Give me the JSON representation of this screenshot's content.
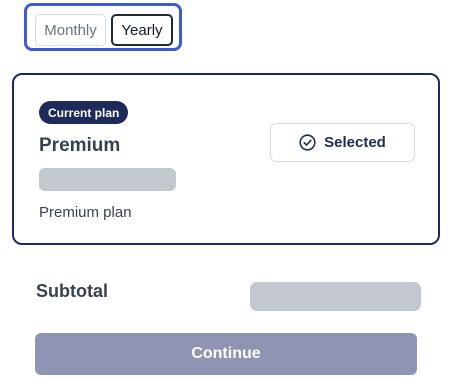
{
  "billing_toggle": {
    "options": [
      {
        "label": "Monthly",
        "selected": false
      },
      {
        "label": "Yearly",
        "selected": true
      }
    ],
    "focus_ring_color": "#3b5bdb"
  },
  "plan": {
    "badge": "Current plan",
    "name": "Premium",
    "description": "Premium plan",
    "selected_button_label": "Selected",
    "selected_icon": "check-circle-icon",
    "price_loading": true
  },
  "summary": {
    "subtotal_label": "Subtotal",
    "subtotal_loading": true
  },
  "actions": {
    "continue_label": "Continue",
    "continue_disabled": true
  },
  "colors": {
    "accent": "#1e2a5a",
    "disabled_button": "#8e94b2",
    "skeleton": "#c3c7ce"
  }
}
